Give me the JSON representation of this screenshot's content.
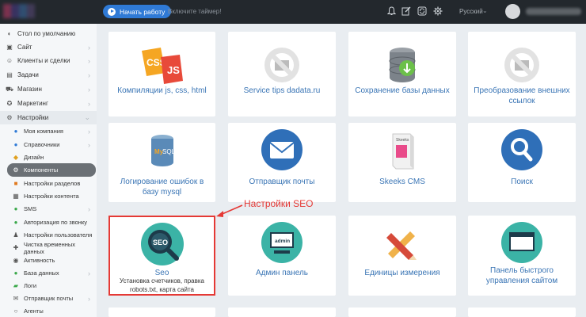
{
  "header": {
    "start_button": "Начать работу",
    "timer_link": "Включите таймер!",
    "language": "Русский"
  },
  "sidebar": {
    "items": [
      {
        "label": "Стол по умолчанию",
        "icon": "dashboard-icon"
      },
      {
        "label": "Сайт",
        "icon": "site-icon"
      },
      {
        "label": "Клиенты и сделки",
        "icon": "clients-icon"
      },
      {
        "label": "Задачи",
        "icon": "tasks-icon"
      },
      {
        "label": "Магазин",
        "icon": "shop-icon"
      },
      {
        "label": "Маркетинг",
        "icon": "marketing-icon"
      },
      {
        "label": "Настройки",
        "icon": "settings-icon"
      },
      {
        "label": "Моя компания",
        "icon": "info-icon"
      },
      {
        "label": "Справочники",
        "icon": "info-icon"
      },
      {
        "label": "Дизайн",
        "icon": "design-icon"
      },
      {
        "label": "Компоненты",
        "icon": "components-icon"
      },
      {
        "label": "Настройки разделов",
        "icon": "sections-icon"
      },
      {
        "label": "Настройки контента",
        "icon": "content-icon"
      },
      {
        "label": "SMS",
        "icon": "sms-icon"
      },
      {
        "label": "Авторизация по звонку",
        "icon": "phone-icon"
      },
      {
        "label": "Настройки пользователя",
        "icon": "user-icon"
      },
      {
        "label": "Чистка временных данных",
        "icon": "clean-icon"
      },
      {
        "label": "Активность",
        "icon": "activity-icon"
      },
      {
        "label": "База данных",
        "icon": "database-icon"
      },
      {
        "label": "Логи",
        "icon": "logs-icon"
      },
      {
        "label": "Отправщик почты",
        "icon": "mail-icon"
      },
      {
        "label": "Агенты",
        "icon": "agents-icon"
      }
    ]
  },
  "cards": [
    {
      "label": "Компиляции js, css, html",
      "icon": "css-js-icon"
    },
    {
      "label": "Service tips dadata.ru",
      "icon": "no-image-icon"
    },
    {
      "label": "Сохранение базы данных",
      "icon": "database-save-icon"
    },
    {
      "label": "Преобразование внешних ссылок",
      "icon": "no-image-icon"
    },
    {
      "label": "Логирование ошибок в базу mysql",
      "icon": "mysql-icon"
    },
    {
      "label": "Отправщик почты",
      "icon": "envelope-icon"
    },
    {
      "label": "Skeeks CMS",
      "icon": "skeeks-box-icon"
    },
    {
      "label": "Поиск",
      "icon": "search-icon"
    },
    {
      "label": "Seo",
      "sub": "Установка счетчиков, правка robots.txt, карта сайта",
      "icon": "seo-icon"
    },
    {
      "label": "Админ панель",
      "icon": "admin-monitor-icon"
    },
    {
      "label": "Единицы измерения",
      "icon": "ruler-pencil-icon"
    },
    {
      "label": "Панель быстрого управления сайтом",
      "icon": "panel-window-icon"
    }
  ],
  "annotation": "Настройки SEO",
  "colors": {
    "accent": "#2f7ad6",
    "link": "#3a75b5",
    "highlight": "#e53935",
    "topbar": "#23282d"
  }
}
